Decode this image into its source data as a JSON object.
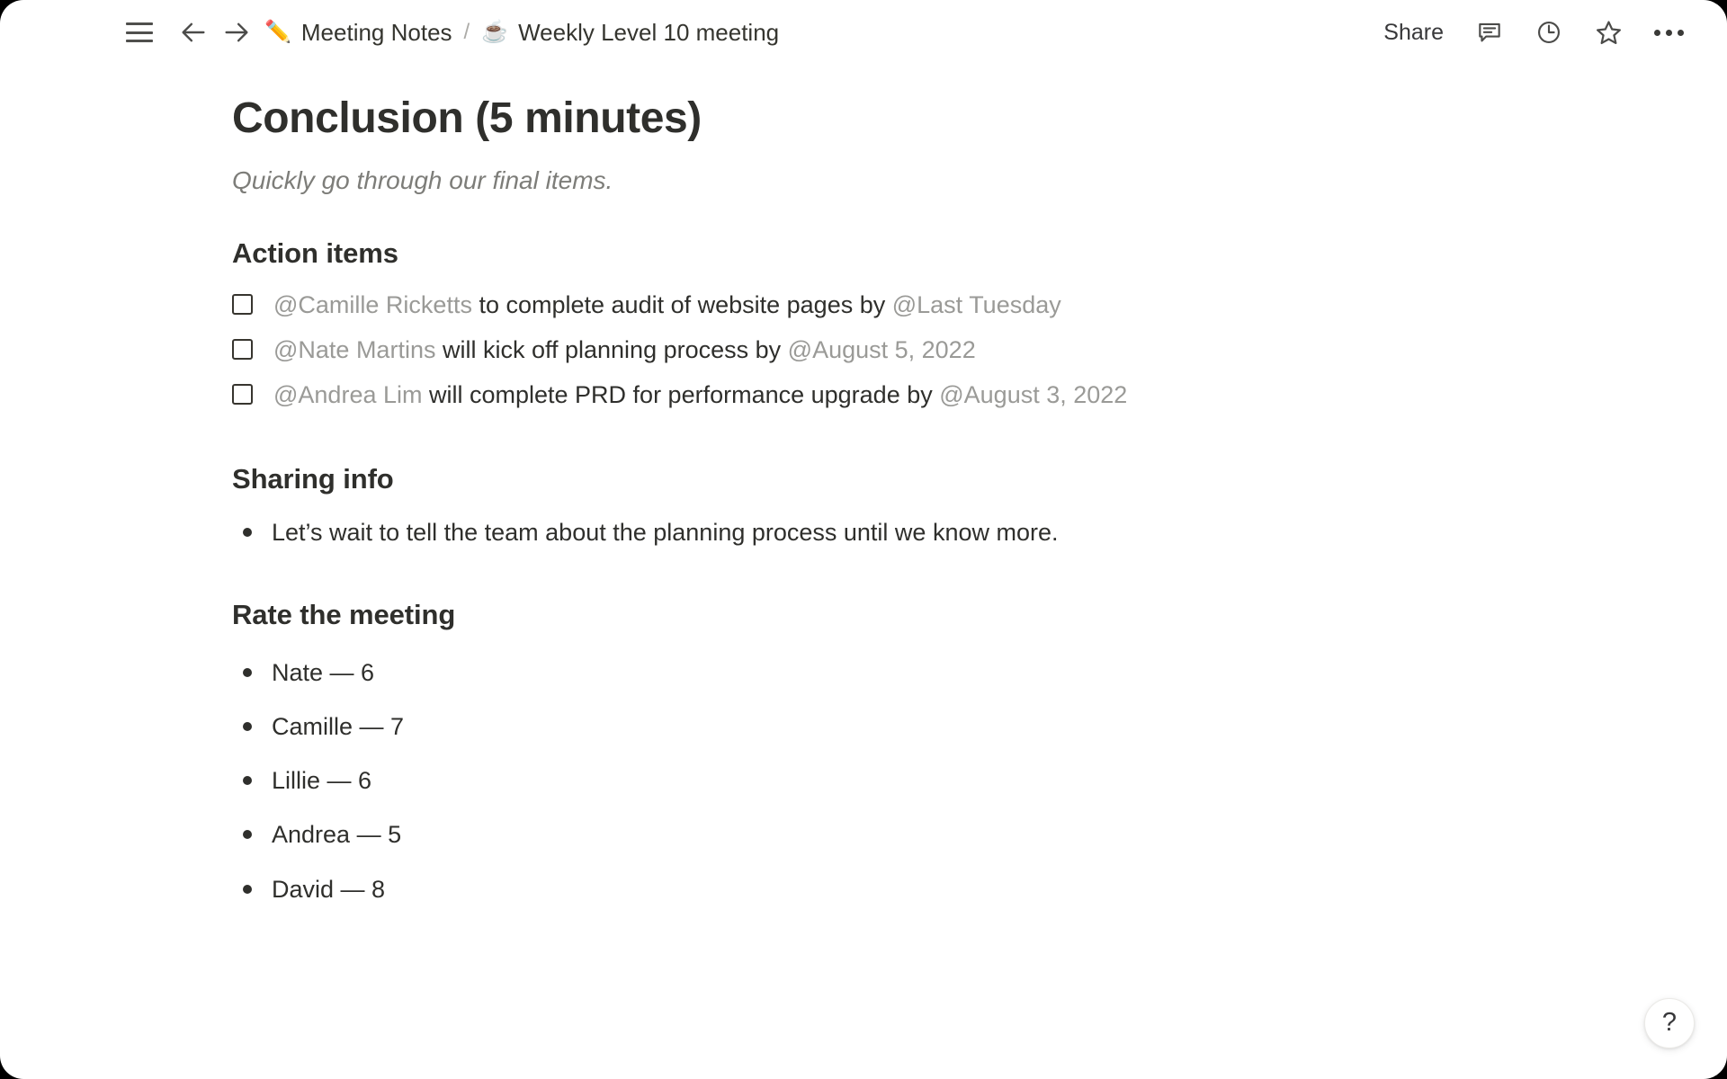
{
  "window": {
    "background_color": "#ffffff",
    "outside_color": "#000000"
  },
  "topbar": {
    "menu_icon": "hamburger-menu-icon",
    "back_icon": "arrow-left-icon",
    "forward_icon": "arrow-right-icon",
    "breadcrumb": {
      "separator": "/",
      "items": [
        {
          "emoji": "✏️",
          "emoji_name": "pencil-emoji",
          "label": "Meeting Notes"
        },
        {
          "emoji": "☕",
          "emoji_name": "coffee-emoji",
          "label": "Weekly Level 10 meeting"
        }
      ]
    },
    "share_label": "Share",
    "comment_icon": "comment-bubble-icon",
    "history_icon": "clock-icon",
    "favorite_icon": "star-icon",
    "more_icon": "more-horizontal-icon"
  },
  "document": {
    "title": "Conclusion (5 minutes)",
    "subtitle": "Quickly go through our final items.",
    "sections": {
      "action_items": {
        "heading": "Action items",
        "items": [
          {
            "checked": false,
            "mention_person": "@Camille Ricketts",
            "text_middle": " to complete audit of website pages by ",
            "mention_date": "@Last Tuesday"
          },
          {
            "checked": false,
            "mention_person": "@Nate Martins",
            "text_middle": " will kick off planning process by ",
            "mention_date": "@August 5, 2022"
          },
          {
            "checked": false,
            "mention_person": "@Andrea Lim",
            "text_middle": " will complete PRD for performance upgrade by ",
            "mention_date": "@August 3, 2022"
          }
        ]
      },
      "sharing_info": {
        "heading": "Sharing info",
        "bullets": [
          "Let’s wait to tell the team about the planning process until we know more."
        ]
      },
      "rate_the_meeting": {
        "heading": "Rate the meeting",
        "bullets": [
          "Nate — 6",
          "Camille — 7",
          "Lillie — 6",
          "Andrea — 5",
          "David — 8"
        ],
        "ratings": [
          {
            "name": "Nate",
            "score": 6
          },
          {
            "name": "Camille",
            "score": 7
          },
          {
            "name": "Lillie",
            "score": 6
          },
          {
            "name": "Andrea",
            "score": 5
          },
          {
            "name": "David",
            "score": 8
          }
        ]
      }
    }
  },
  "help": {
    "label": "?",
    "icon": "question-mark-icon"
  },
  "colors": {
    "text_primary": "#2f2f2c",
    "text_mention": "#9a9a97",
    "text_subtitle": "#7d7d79",
    "icon": "#4b4b49"
  }
}
